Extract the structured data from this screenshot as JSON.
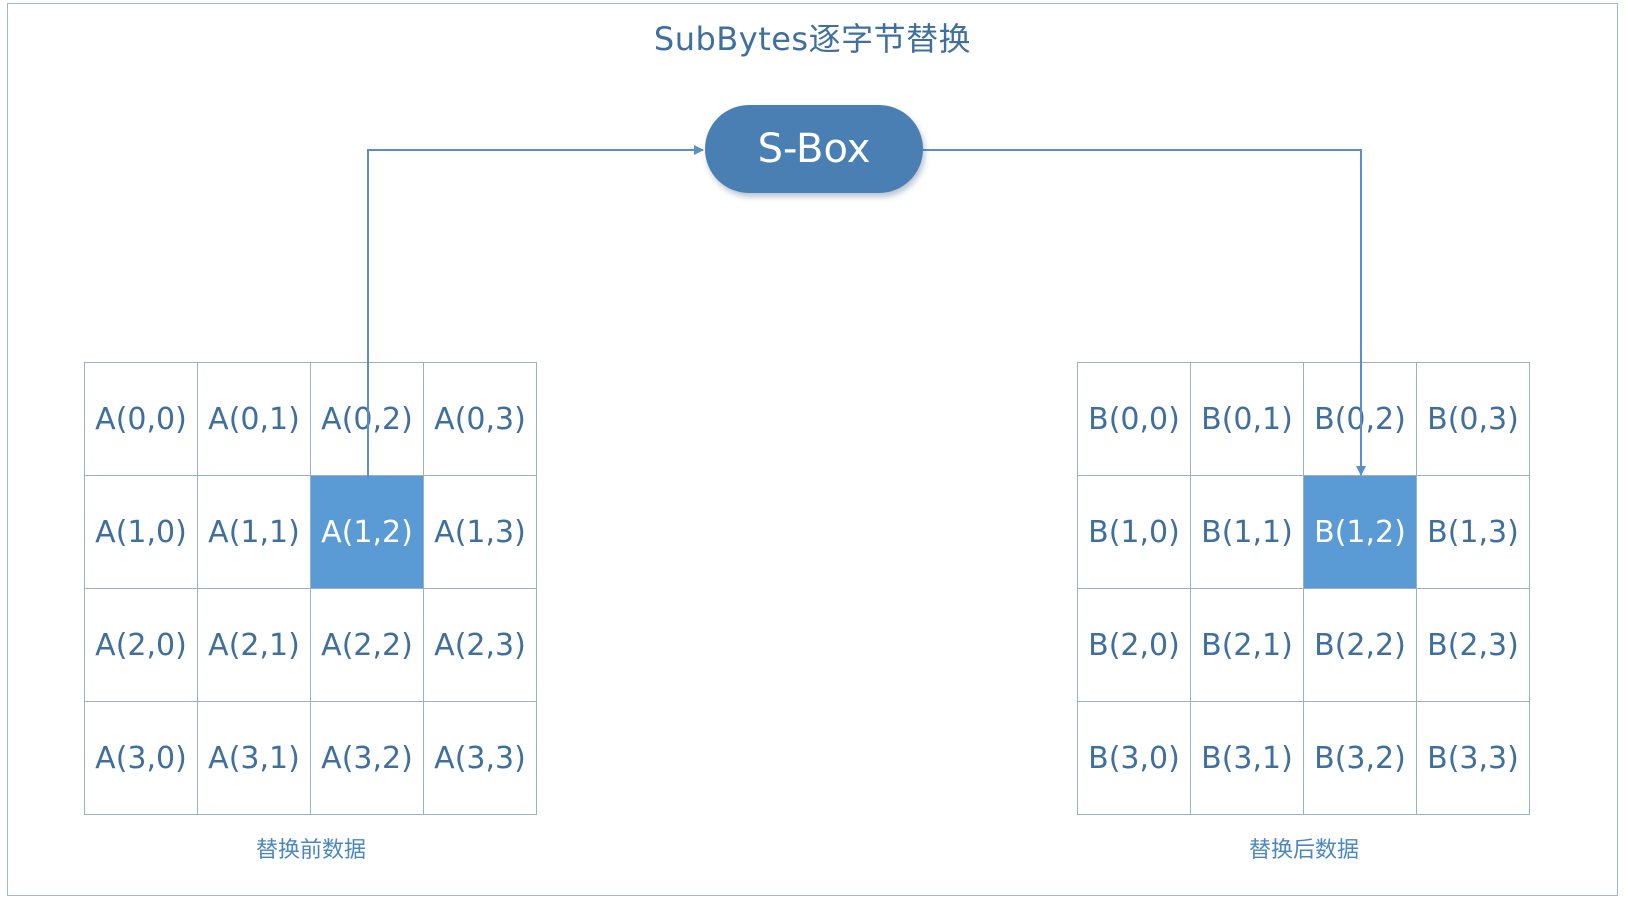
{
  "title": "SubBytes逐字节替换",
  "sbox": {
    "label": "S-Box"
  },
  "grid_before": {
    "caption": "替换前数据",
    "highlight": [
      1,
      2
    ],
    "rows": [
      [
        "A(0,0)",
        "A(0,1)",
        "A(0,2)",
        "A(0,3)"
      ],
      [
        "A(1,0)",
        "A(1,1)",
        "A(1,2)",
        "A(1,3)"
      ],
      [
        "A(2,0)",
        "A(2,1)",
        "A(2,2)",
        "A(2,3)"
      ],
      [
        "A(3,0)",
        "A(3,1)",
        "A(3,2)",
        "A(3,3)"
      ]
    ]
  },
  "grid_after": {
    "caption": "替换后数据",
    "highlight": [
      1,
      2
    ],
    "rows": [
      [
        "B(0,0)",
        "B(0,1)",
        "B(0,2)",
        "B(0,3)"
      ],
      [
        "B(1,0)",
        "B(1,1)",
        "B(1,2)",
        "B(1,3)"
      ],
      [
        "B(2,0)",
        "B(2,1)",
        "B(2,2)",
        "B(2,3)"
      ],
      [
        "B(3,0)",
        "B(3,1)",
        "B(3,2)",
        "B(3,3)"
      ]
    ]
  },
  "colors": {
    "highlight": "#5b9bd5",
    "sbox": "#4a7fb3",
    "text": "#3f6f9f",
    "connector": "#5b8fc7"
  }
}
